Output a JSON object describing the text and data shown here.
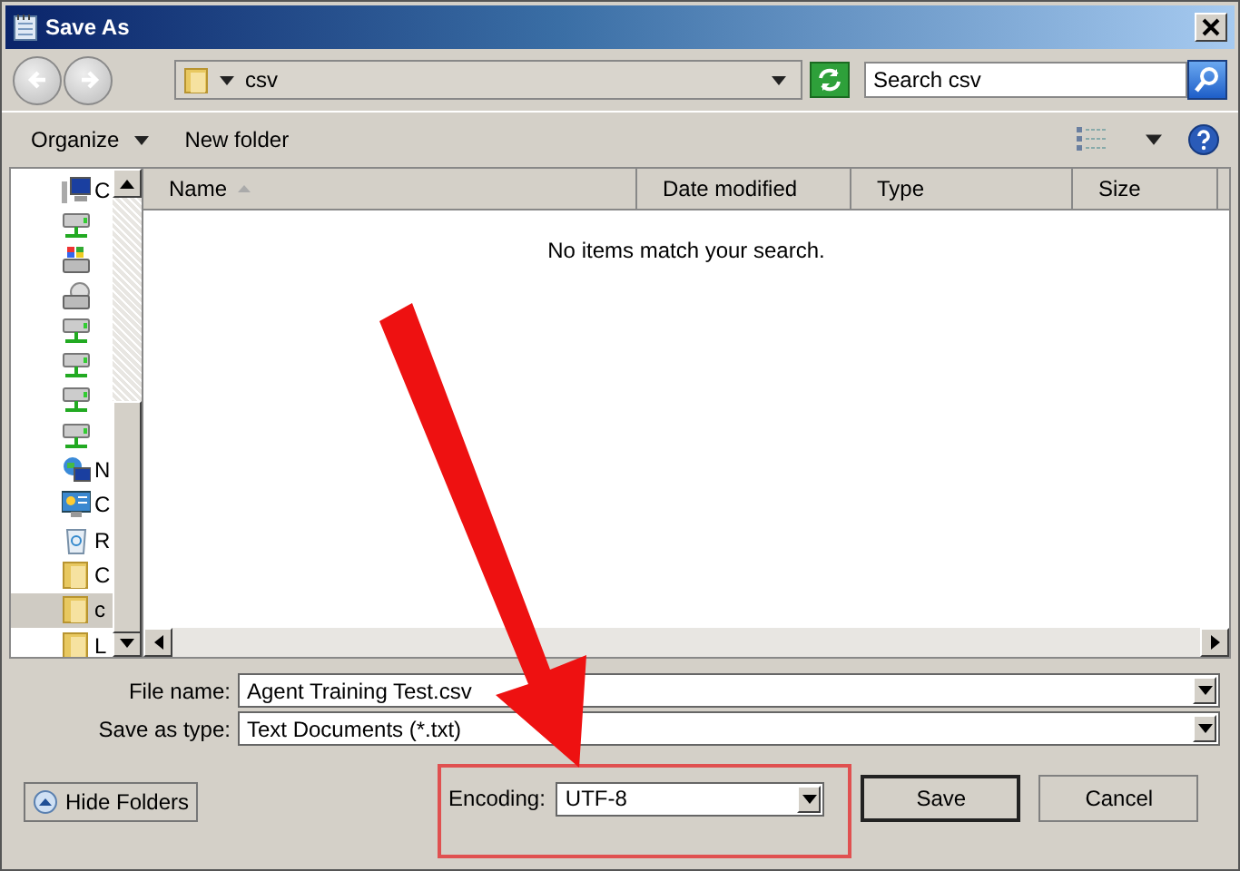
{
  "window": {
    "title": "Save As"
  },
  "address": {
    "path": "csv"
  },
  "search": {
    "placeholder": "Search csv"
  },
  "toolbar": [
    {
      "label": "Organize",
      "kind": "menu"
    },
    {
      "label": "New folder",
      "kind": "plain"
    }
  ],
  "nav_items": [
    {
      "kind": "computer",
      "label": "C",
      "selected": false
    },
    {
      "kind": "drive",
      "selected": false
    },
    {
      "kind": "system-drive",
      "selected": false
    },
    {
      "kind": "optical-drive",
      "selected": false
    },
    {
      "kind": "drive",
      "selected": false
    },
    {
      "kind": "drive",
      "selected": false
    },
    {
      "kind": "drive",
      "selected": false
    },
    {
      "kind": "drive",
      "selected": false
    },
    {
      "kind": "network",
      "label": "N",
      "selected": false
    },
    {
      "kind": "control-panel",
      "label": "C",
      "selected": false
    },
    {
      "kind": "recycle-bin",
      "label": "R",
      "selected": false
    },
    {
      "kind": "folder",
      "label": "C",
      "selected": false
    },
    {
      "kind": "folder",
      "label": "c",
      "selected": true
    },
    {
      "kind": "folder",
      "label": "L",
      "selected": false
    }
  ],
  "columns": [
    {
      "label": "Name",
      "sorted": true
    },
    {
      "label": "Date modified",
      "sorted": false
    },
    {
      "label": "Type",
      "sorted": false
    },
    {
      "label": "Size",
      "sorted": false
    }
  ],
  "empty_message": "No items match your search.",
  "file_name": {
    "label": "File name:",
    "value": "Agent Training Test.csv"
  },
  "save_type": {
    "label": "Save as type:",
    "value": "Text Documents (*.txt)"
  },
  "encoding": {
    "label": "Encoding:",
    "value": "UTF-8"
  },
  "hide_folders": "Hide Folders",
  "buttons": [
    {
      "label": "Save",
      "default": true
    },
    {
      "label": "Cancel",
      "default": false
    }
  ]
}
